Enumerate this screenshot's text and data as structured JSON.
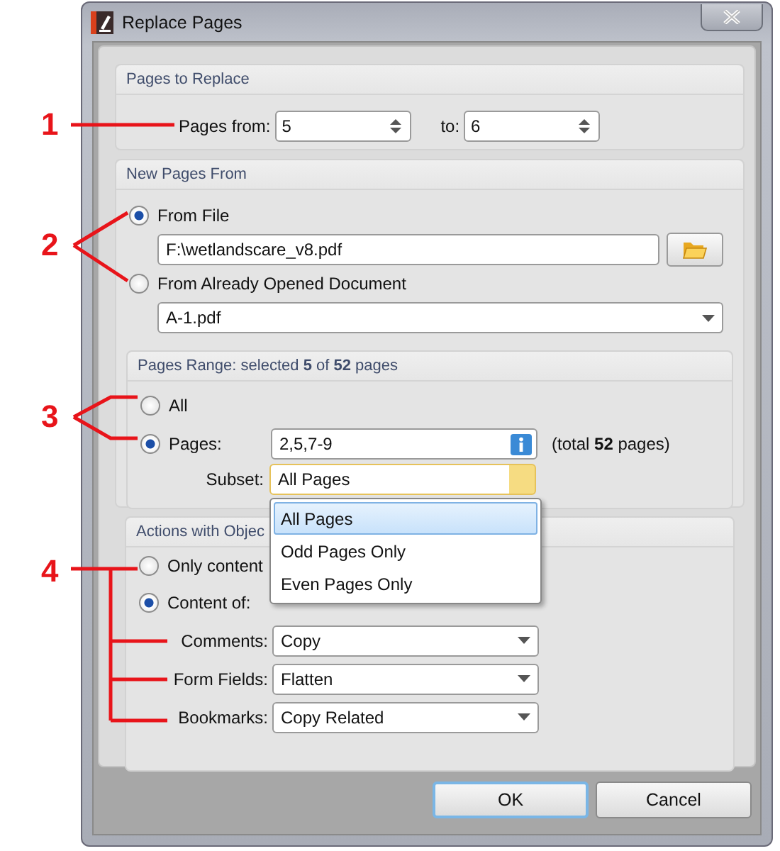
{
  "window": {
    "title": "Replace Pages"
  },
  "pages_to_replace": {
    "title": "Pages to Replace",
    "from_label": "Pages from:",
    "from_value": "5",
    "to_label": "to:",
    "to_value": "6"
  },
  "new_pages_from": {
    "title": "New Pages From",
    "options": [
      {
        "label": "From File",
        "selected": true
      },
      {
        "label": "From Already Opened Document",
        "selected": false
      }
    ],
    "file_path": "F:\\wetlandscare_v8.pdf",
    "document": "A-1.pdf"
  },
  "pages_range": {
    "title": "Pages Range: selected **5** of **52** pages",
    "options": [
      {
        "label": "All",
        "selected": false
      },
      {
        "label": "Pages:",
        "selected": true
      }
    ],
    "pages_value": "2,5,7-9",
    "total": "(total **52** pages)",
    "subset_label": "Subset:",
    "subset_value": "All Pages",
    "subset_expanded": true,
    "subset_options": [
      {
        "label": "All Pages",
        "selected": true
      },
      {
        "label": "Odd Pages Only",
        "selected": false
      },
      {
        "label": "Even Pages Only",
        "selected": false
      }
    ]
  },
  "actions": {
    "title": "Actions with Objec",
    "options": [
      {
        "label": "Only content",
        "selected": false
      },
      {
        "label": "Content of:",
        "selected": true
      }
    ],
    "rows": [
      {
        "label": "Comments:",
        "value": "Copy"
      },
      {
        "label": "Form Fields:",
        "value": "Flatten"
      },
      {
        "label": "Bookmarks:",
        "value": "Copy Related"
      }
    ]
  },
  "buttons": [
    {
      "label": "OK",
      "default": true
    },
    {
      "label": "Cancel",
      "default": false
    }
  ],
  "callouts": [
    "1",
    "2",
    "3",
    "4"
  ]
}
